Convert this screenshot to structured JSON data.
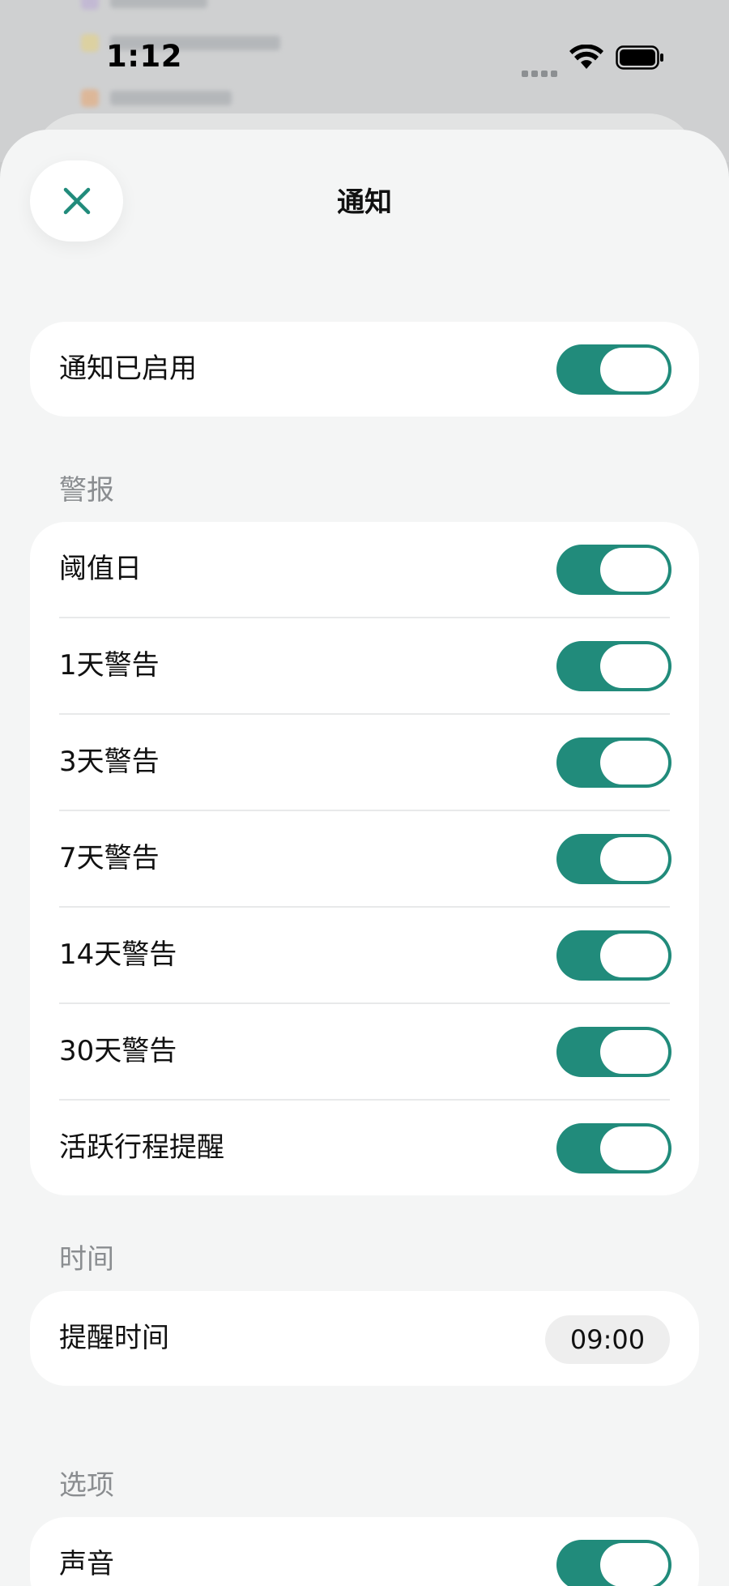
{
  "status_bar": {
    "time": "1:12"
  },
  "sheet": {
    "title": "通知",
    "close_icon": "close-icon"
  },
  "master": {
    "label": "通知已启用",
    "enabled": true
  },
  "alerts": {
    "header": "警报",
    "items": [
      {
        "label": "阈值日",
        "enabled": true
      },
      {
        "label": "1天警告",
        "enabled": true
      },
      {
        "label": "3天警告",
        "enabled": true
      },
      {
        "label": "7天警告",
        "enabled": true
      },
      {
        "label": "14天警告",
        "enabled": true
      },
      {
        "label": "30天警告",
        "enabled": true
      },
      {
        "label": "活跃行程提醒",
        "enabled": true
      }
    ]
  },
  "time": {
    "header": "时间",
    "reminder_label": "提醒时间",
    "reminder_value": "09:00"
  },
  "options": {
    "header": "选项",
    "items": [
      {
        "label": "声音",
        "enabled": true
      }
    ]
  },
  "colors": {
    "accent": "#218b7b",
    "sheet_bg": "#f4f5f5",
    "card_bg": "#ffffff",
    "section_text": "#8a8d90"
  }
}
